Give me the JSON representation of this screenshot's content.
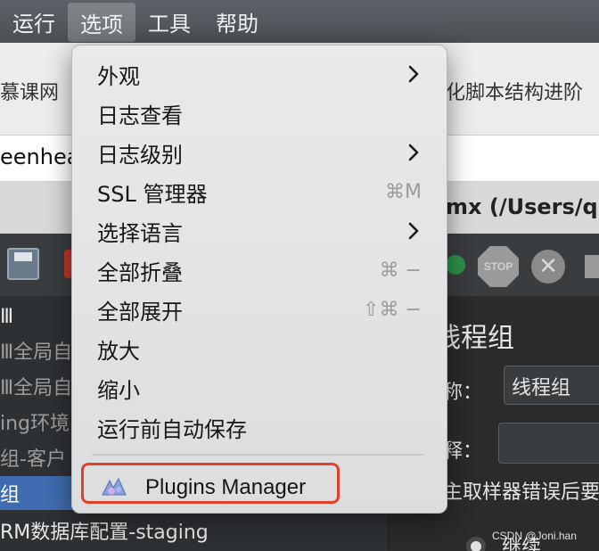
{
  "menubar": {
    "items": [
      "运行",
      "选项",
      "工具",
      "帮助"
    ],
    "active_index": 1
  },
  "background": {
    "tab_left": "慕课网",
    "tab_right": "化脚本结构进阶",
    "url_fragment": "eenhea",
    "window_title": "mx (/Users/qin",
    "tree_items": [
      {
        "text": "Ⅲ",
        "style": "light"
      },
      {
        "text": "Ⅲ全局自定",
        "style": "dim"
      },
      {
        "text": "Ⅲ全局自定",
        "style": "dim"
      },
      {
        "text": "ing环境",
        "style": "dim"
      },
      {
        "text": "组-客户",
        "style": "dim"
      },
      {
        "text": "组",
        "style": "selected"
      },
      {
        "text": "RM数据库配置-staging",
        "style": "light"
      }
    ],
    "panel_heading": "线程组",
    "name_label": "称：",
    "name_value": "线程组",
    "comment_label": "释：",
    "error_label": "主取样器错误后要",
    "radio_label": "继续",
    "stop_label": "STOP"
  },
  "options_menu": {
    "items": [
      {
        "label": "外观",
        "submenu": true,
        "shortcut": ""
      },
      {
        "label": "日志查看",
        "submenu": false,
        "shortcut": ""
      },
      {
        "label": "日志级别",
        "submenu": true,
        "shortcut": ""
      },
      {
        "label": "SSL 管理器",
        "submenu": false,
        "shortcut": "⌘M"
      },
      {
        "label": "选择语言",
        "submenu": true,
        "shortcut": ""
      },
      {
        "label": "全部折叠",
        "submenu": false,
        "shortcut": "⌘ −"
      },
      {
        "label": "全部展开",
        "submenu": false,
        "shortcut": "⇧⌘ −"
      },
      {
        "label": "放大",
        "submenu": false,
        "shortcut": ""
      },
      {
        "label": "缩小",
        "submenu": false,
        "shortcut": ""
      },
      {
        "label": "运行前自动保存",
        "submenu": false,
        "shortcut": ""
      }
    ],
    "plugins_manager": "Plugins Manager"
  },
  "watermark": "CSDN @Joni.han",
  "colors": {
    "highlight_border": "#e0402b",
    "selection": "#3f6cb0"
  }
}
